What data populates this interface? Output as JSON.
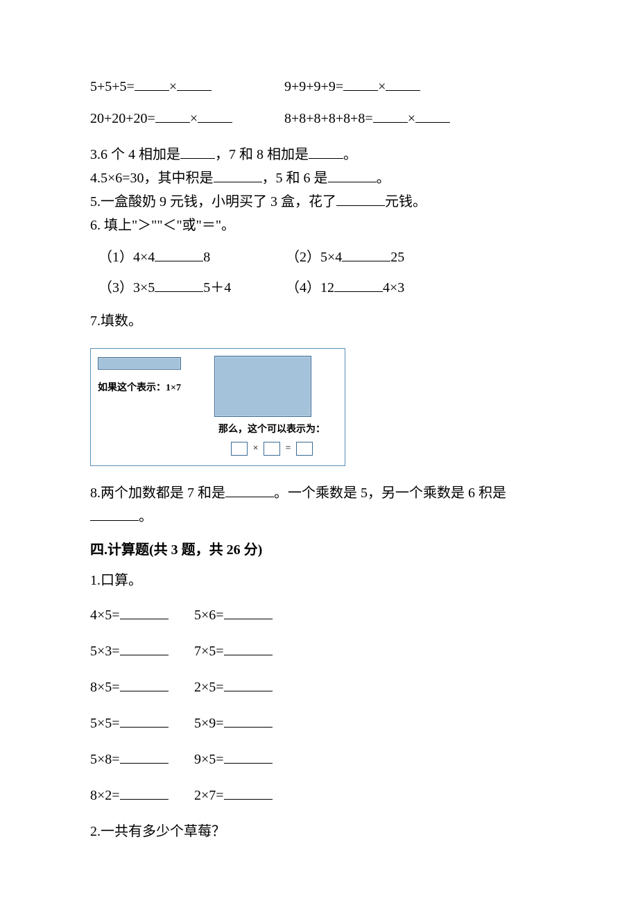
{
  "q2_rows": [
    {
      "left_expr": "5+5+5=",
      "right_expr": "9+9+9+9="
    },
    {
      "left_expr": "20+20+20=",
      "right_expr": "8+8+8+8+8+8="
    }
  ],
  "q3": {
    "prefix": "3.6 个 4 相加是",
    "mid": "，7 和 8 相加是",
    "suffix": "。"
  },
  "q4": {
    "prefix": "4.5×6=30，其中积是",
    "mid": "，5 和 6 是",
    "suffix": "。"
  },
  "q5": {
    "prefix": "5.一盒酸奶 9 元钱，小明买了 3 盒，花了",
    "suffix": "元钱。"
  },
  "q6": {
    "title": "6.   填上\"＞\"\"＜\"或\"＝\"。",
    "items": [
      {
        "a": "（1）4×4",
        "b": "8",
        "c": "（2）5×4",
        "d": "25"
      },
      {
        "a": "（3）3×5",
        "b": "5＋4",
        "c": "（4）12",
        "d": "4×3"
      }
    ]
  },
  "q7": {
    "title": "7.填数。",
    "fig_left": "如果这个表示：1×7",
    "fig_right": "那么，这个可以表示为：",
    "op1": "×",
    "op2": "="
  },
  "q8": {
    "prefix": "8.两个加数都是 7 和是",
    "mid": "。一个乘数是 5，另一个乘数是 6 积是",
    "suffix": "。"
  },
  "section4_heading": "四.计算题(共 3 题，共 26 分)",
  "s4_q1_title": "1.口算。",
  "s4_q1_rows": [
    {
      "a": "4×5=",
      "b": "5×6="
    },
    {
      "a": "5×3=",
      "b": "7×5="
    },
    {
      "a": "8×5=",
      "b": "2×5="
    },
    {
      "a": "5×5=",
      "b": "5×9="
    },
    {
      "a": "5×8=",
      "b": "9×5="
    },
    {
      "a": "8×2=",
      "b": "2×7="
    }
  ],
  "s4_q2_title": "2.一共有多少个草莓？",
  "mult_sign": "×"
}
